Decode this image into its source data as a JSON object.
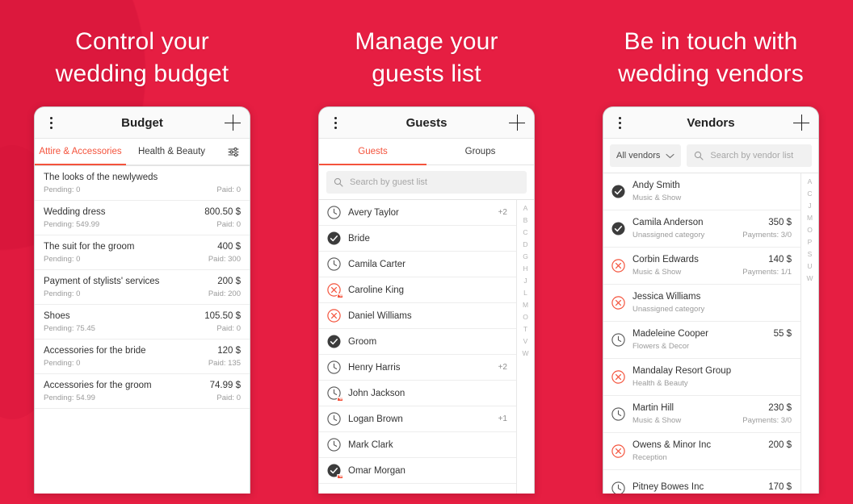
{
  "theme": {
    "background": "#E61E42",
    "accent": "#F4533C",
    "text_primary": "#333333",
    "text_secondary": "#9B9B9B",
    "status_confirmed": "#3C3C3C",
    "status_declined": "#F4533C",
    "status_pending": "#555555"
  },
  "panels": [
    {
      "headline": "Control your\nwedding budget",
      "appbar": {
        "title": "Budget",
        "menu_icon": "kebab-menu-icon",
        "add_icon": "plus-icon"
      },
      "tabs": [
        {
          "label": "Attire & Accessories",
          "active": true
        },
        {
          "label": "Health & Beauty",
          "active": false
        }
      ],
      "filter_icon": "tune-filter-icon",
      "rows": [
        {
          "title": "The looks of the newlyweds",
          "amount": "",
          "pending": "Pending: 0",
          "paid": "Paid: 0"
        },
        {
          "title": "Wedding dress",
          "amount": "800.50 $",
          "pending": "Pending: 549.99",
          "paid": "Paid: 0"
        },
        {
          "title": "The suit for the groom",
          "amount": "400 $",
          "pending": "Pending: 0",
          "paid": "Paid: 300"
        },
        {
          "title": "Payment of stylists' services",
          "amount": "200 $",
          "pending": "Pending: 0",
          "paid": "Paid: 200"
        },
        {
          "title": "Shoes",
          "amount": "105.50 $",
          "pending": "Pending: 75.45",
          "paid": "Paid: 0"
        },
        {
          "title": "Accessories for the bride",
          "amount": "120 $",
          "pending": "Pending: 0",
          "paid": "Paid: 135"
        },
        {
          "title": "Accessories for the groom",
          "amount": "74.99 $",
          "pending": "Pending: 54.99",
          "paid": "Paid: 0"
        }
      ]
    },
    {
      "headline": "Manage your\nguests list",
      "appbar": {
        "title": "Guests",
        "menu_icon": "kebab-menu-icon",
        "add_icon": "plus-icon"
      },
      "tabs": [
        {
          "label": "Guests",
          "active": true
        },
        {
          "label": "Groups",
          "active": false
        }
      ],
      "search": {
        "placeholder": "Search by guest list",
        "icon": "search-icon"
      },
      "index_letters": [
        "A",
        "B",
        "C",
        "D",
        "G",
        "H",
        "J",
        "L",
        "M",
        "O",
        "T",
        "V",
        "W"
      ],
      "rows": [
        {
          "name": "Avery Taylor",
          "status": "pending",
          "badge": false,
          "extra": "+2"
        },
        {
          "name": "Bride",
          "status": "confirmed",
          "badge": false,
          "extra": ""
        },
        {
          "name": "Camila Carter",
          "status": "pending",
          "badge": false,
          "extra": ""
        },
        {
          "name": "Caroline King",
          "status": "declined",
          "badge": true,
          "extra": ""
        },
        {
          "name": "Daniel Williams",
          "status": "declined",
          "badge": false,
          "extra": ""
        },
        {
          "name": "Groom",
          "status": "confirmed",
          "badge": false,
          "extra": ""
        },
        {
          "name": "Henry Harris",
          "status": "pending",
          "badge": false,
          "extra": "+2"
        },
        {
          "name": "John Jackson",
          "status": "pending",
          "badge": true,
          "extra": ""
        },
        {
          "name": "Logan Brown",
          "status": "pending",
          "badge": false,
          "extra": "+1"
        },
        {
          "name": "Mark Clark",
          "status": "pending",
          "badge": false,
          "extra": ""
        },
        {
          "name": "Omar Morgan",
          "status": "confirmed",
          "badge": true,
          "extra": ""
        }
      ]
    },
    {
      "headline": "Be in touch with\nwedding vendors",
      "appbar": {
        "title": "Vendors",
        "menu_icon": "kebab-menu-icon",
        "add_icon": "plus-icon"
      },
      "dropdown": {
        "label": "All vendors",
        "icon": "chevron-down-icon"
      },
      "search": {
        "placeholder": "Search by vendor list",
        "icon": "search-icon"
      },
      "index_letters": [
        "A",
        "C",
        "J",
        "M",
        "O",
        "P",
        "S",
        "U",
        "W"
      ],
      "rows": [
        {
          "name": "Andy Smith",
          "status": "confirmed",
          "amount": "",
          "category": "Music & Show",
          "payments": ""
        },
        {
          "name": "Camila Anderson",
          "status": "confirmed",
          "amount": "350 $",
          "category": "Unassigned category",
          "payments": "Payments: 3/0"
        },
        {
          "name": "Corbin Edwards",
          "status": "declined",
          "amount": "140 $",
          "category": "Music & Show",
          "payments": "Payments: 1/1"
        },
        {
          "name": "Jessica Williams",
          "status": "declined",
          "amount": "",
          "category": "Unassigned category",
          "payments": ""
        },
        {
          "name": "Madeleine Cooper",
          "status": "pending",
          "amount": "55 $",
          "category": "Flowers & Decor",
          "payments": ""
        },
        {
          "name": "Mandalay Resort Group",
          "status": "declined",
          "amount": "",
          "category": "Health & Beauty",
          "payments": ""
        },
        {
          "name": "Martin Hill",
          "status": "pending",
          "amount": "230 $",
          "category": "Music & Show",
          "payments": "Payments: 3/0"
        },
        {
          "name": "Owens & Minor Inc",
          "status": "declined",
          "amount": "200 $",
          "category": "Reception",
          "payments": ""
        },
        {
          "name": "Pitney Bowes Inc",
          "status": "pending",
          "amount": "170 $",
          "category": "",
          "payments": ""
        }
      ]
    }
  ]
}
